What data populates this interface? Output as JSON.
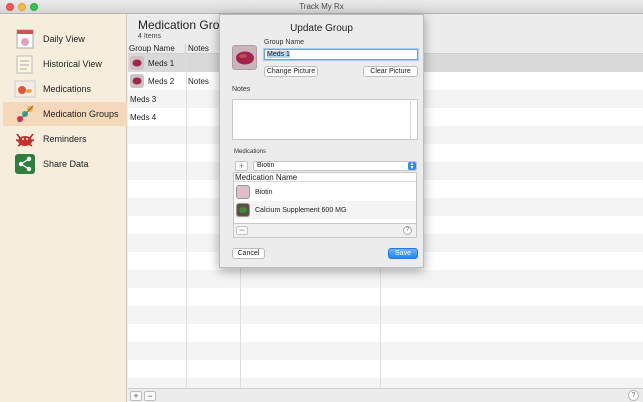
{
  "window": {
    "title": "Track My Rx"
  },
  "sidebar": {
    "items": [
      {
        "label": "Daily View",
        "icon": "calendar-pill-icon"
      },
      {
        "label": "Historical View",
        "icon": "notes-history-icon"
      },
      {
        "label": "Medications",
        "icon": "pills-icon"
      },
      {
        "label": "Medication Groups",
        "icon": "pill-group-icon",
        "selected": true
      },
      {
        "label": "Reminders",
        "icon": "alarm-crab-icon"
      },
      {
        "label": "Share Data",
        "icon": "share-icon"
      }
    ]
  },
  "main": {
    "title": "Medication Groups",
    "count": "4 Items",
    "columns": [
      "Group Name",
      "Notes"
    ],
    "rows": [
      {
        "name": "Meds 1",
        "notes": "",
        "has_icon": true,
        "selected": true
      },
      {
        "name": "Meds 2",
        "notes": "Notes",
        "has_icon": true
      },
      {
        "name": "Meds 3",
        "notes": "",
        "has_icon": false
      },
      {
        "name": "Meds 4",
        "notes": "",
        "has_icon": false
      }
    ],
    "add_label": "+",
    "remove_label": "−",
    "help_label": "?"
  },
  "dialog": {
    "title": "Update Group",
    "group_name_label": "Group Name",
    "group_name_value": "Meds 1",
    "change_picture": "Change Picture",
    "clear_picture": "Clear Picture",
    "notes_label": "Notes",
    "notes_value": "",
    "medications_label": "Medications",
    "add_label": "+",
    "select_value": "Biotin",
    "med_column": "Medication Name",
    "medications": [
      {
        "name": "Biotin",
        "icon": "pink-pill-icon"
      },
      {
        "name": "Calcium Supplement 600 MG",
        "icon": "green-pill-icon"
      }
    ],
    "remove_label": "−",
    "help_label": "?",
    "cancel": "Cancel",
    "save": "Save"
  },
  "colors": {
    "sidebar_bg": "#f6eddc",
    "sidebar_selected": "#f3d9b9",
    "accent_blue": "#1f87f5",
    "desktop_pink": "#f0c9d1"
  }
}
